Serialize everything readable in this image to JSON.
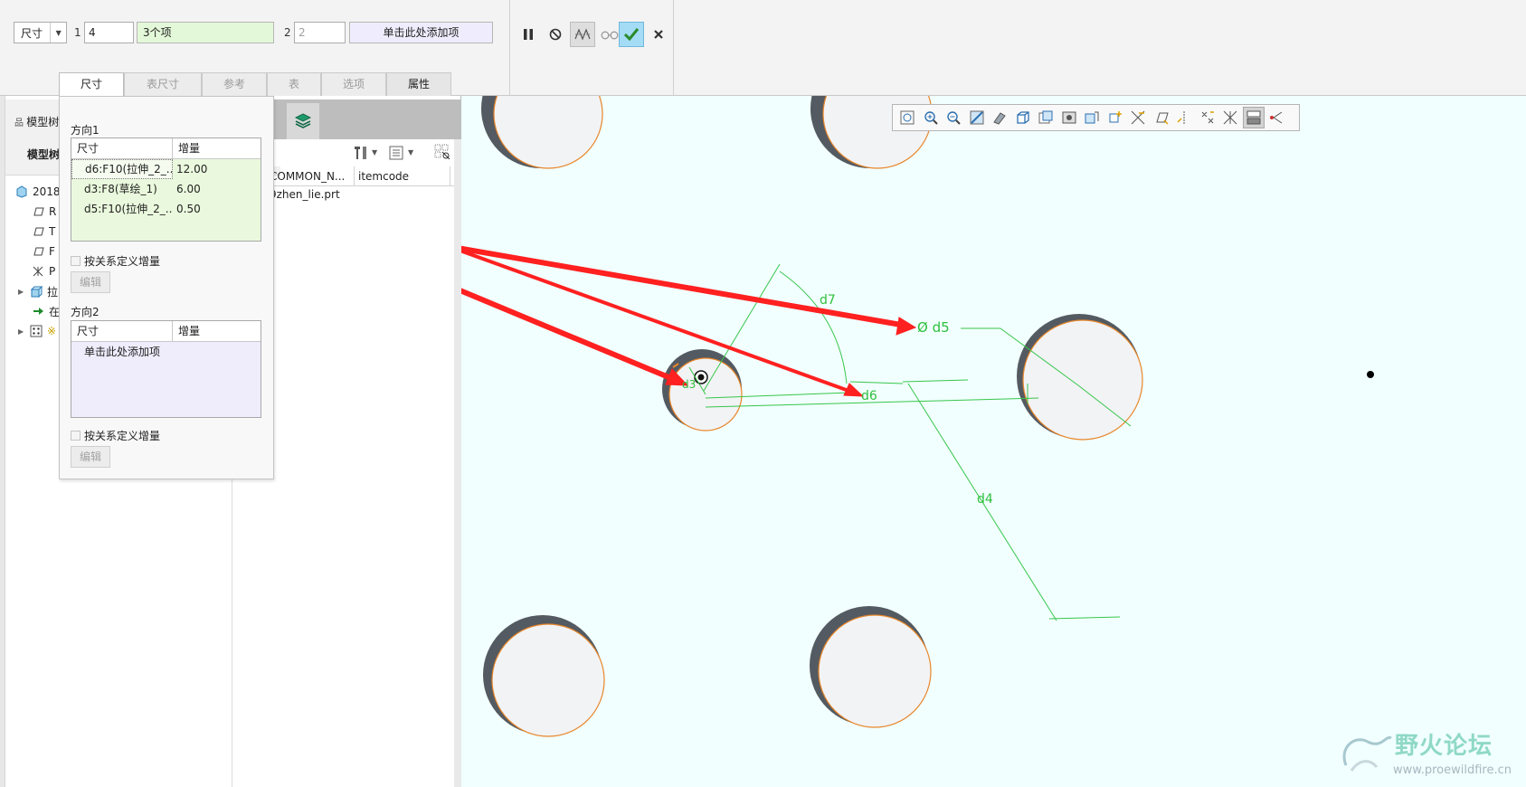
{
  "dashboard": {
    "type_select": "尺寸",
    "dir1_index": "1",
    "dir1_count": "4",
    "dir1_collector": "3个项",
    "dir2_index": "2",
    "dir2_count": "2",
    "dir2_collector": "单击此处添加项",
    "tabs": [
      "尺寸",
      "表尺寸",
      "参考",
      "表",
      "选项",
      "属性"
    ],
    "actions": [
      "pause-icon",
      "no-preview-icon",
      "preview-icon",
      "glasses-icon",
      "check-icon",
      "close-icon"
    ]
  },
  "model_tree": {
    "tab_short": "模型树",
    "header": "模型树",
    "rows": [
      "2018",
      "R",
      "T",
      "F",
      "P",
      "拉",
      "在",
      "※"
    ]
  },
  "detail": {
    "col1": "COMMON_N...",
    "col2": "itemcode",
    "row1": "9zhen_lie.prt"
  },
  "dim_panel": {
    "dir1_label": "方向1",
    "dir2_label": "方向2",
    "col_dim": "尺寸",
    "col_inc": "增量",
    "dir1_rows": [
      {
        "dim": "d6:F10(拉伸_2_...",
        "inc": "12.00"
      },
      {
        "dim": "d3:F8(草绘_1)",
        "inc": "6.00"
      },
      {
        "dim": "d5:F10(拉伸_2_...",
        "inc": "0.50"
      }
    ],
    "dir2_placeholder": "单击此处添加项",
    "relation_check": "按关系定义增量",
    "edit_button": "编辑"
  },
  "graphics": {
    "dims": [
      "d7",
      "Ø d5",
      "d3",
      "d6",
      "d4"
    ]
  },
  "watermark": {
    "title": "野火论坛",
    "url": "www.proewildfire.cn"
  },
  "colors": {
    "accent_green_dim": "#2fbf3c",
    "arrow_red": "#ff2020",
    "collector_green": "#e3f8d8",
    "collector_violet": "#efedfd",
    "graphics_bg": "#f1ffff",
    "ok_button": "#a4dcf6"
  }
}
